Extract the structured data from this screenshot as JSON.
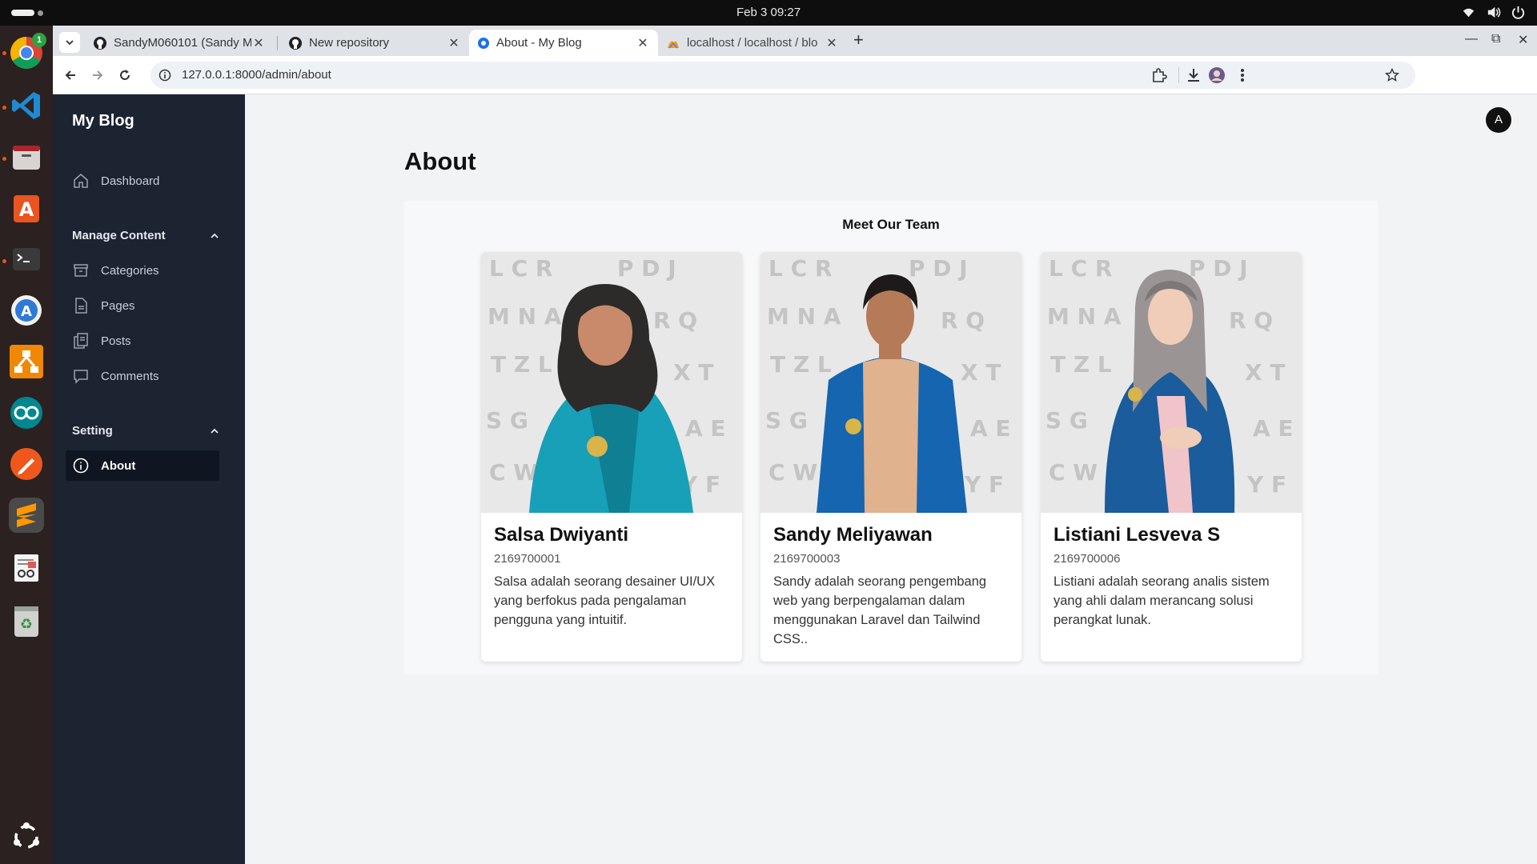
{
  "system": {
    "clock": "Feb 3  09:27",
    "tray_icons": [
      "wifi-icon",
      "volume-icon",
      "power-icon"
    ]
  },
  "dock": {
    "apps": [
      {
        "name": "chrome",
        "badge": "1"
      },
      {
        "name": "vscode"
      },
      {
        "name": "files"
      },
      {
        "name": "app-center"
      },
      {
        "name": "terminal"
      },
      {
        "name": "software-updater"
      },
      {
        "name": "drawio"
      },
      {
        "name": "arduino"
      },
      {
        "name": "inkscape"
      },
      {
        "name": "sublime-text"
      },
      {
        "name": "text-viewer"
      },
      {
        "name": "trash"
      },
      {
        "name": "show-apps"
      }
    ]
  },
  "browser": {
    "tabs": [
      {
        "title": "SandyM060101 (Sandy M",
        "icon": "github-icon"
      },
      {
        "title": "New repository",
        "icon": "github-icon"
      },
      {
        "title": "About - My Blog",
        "icon": "globe-icon",
        "active": true
      },
      {
        "title": "localhost / localhost / blo",
        "icon": "phpmyadmin-icon"
      }
    ],
    "url": "127.0.0.1:8000/admin/about"
  },
  "sidebar": {
    "brand": "My Blog",
    "dashboard": "Dashboard",
    "group_manage": "Manage Content",
    "categories": "Categories",
    "pages": "Pages",
    "posts": "Posts",
    "comments": "Comments",
    "group_setting": "Setting",
    "about": "About"
  },
  "header": {
    "avatar_letter": "A"
  },
  "main": {
    "title": "About",
    "section_title": "Meet Our Team",
    "team": [
      {
        "name": "Salsa Dwiyanti",
        "nim": "2169700001",
        "bio": "Salsa adalah seorang desainer UI/UX yang berfokus pada pengalaman pengguna yang intuitif."
      },
      {
        "name": "Sandy Meliyawan",
        "nim": "2169700003",
        "bio": "Sandy adalah seorang pengembang web yang berpengalaman dalam menggunakan Laravel dan Tailwind CSS.."
      },
      {
        "name": "Listiani Lesveva S",
        "nim": "2169700006",
        "bio": "Listiani adalah seorang analis sistem yang ahli dalam merancang solusi perangkat lunak."
      }
    ]
  },
  "colors": {
    "sidebar_bg": "#1c2331",
    "active_item_bg": "#0f1622",
    "page_bg": "#f1f3f5",
    "jacket_teal": "#17a0b8",
    "jacket_blue": "#1565b0"
  }
}
